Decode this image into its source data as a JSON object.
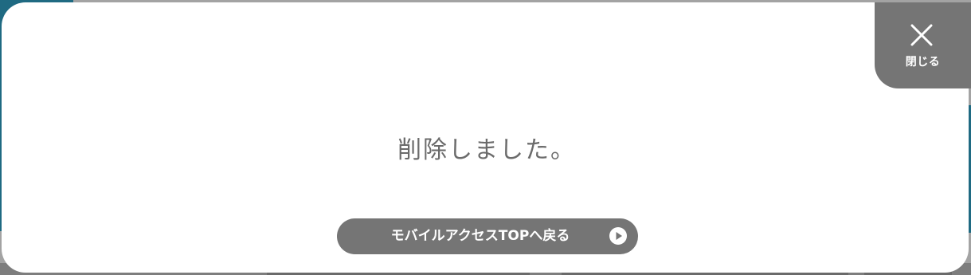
{
  "dialog": {
    "close_label": "閉じる",
    "message": "削除しました。",
    "top_button_label": "モバイルアクセスTOPへ戻る"
  },
  "icons": {
    "close": "close-x-icon",
    "play": "play-circle-icon"
  },
  "colors": {
    "modal_background": "#ffffff",
    "button_gray": "#757575",
    "message_text": "#6b6b6b",
    "backdrop_teal": "#1f6a82"
  }
}
